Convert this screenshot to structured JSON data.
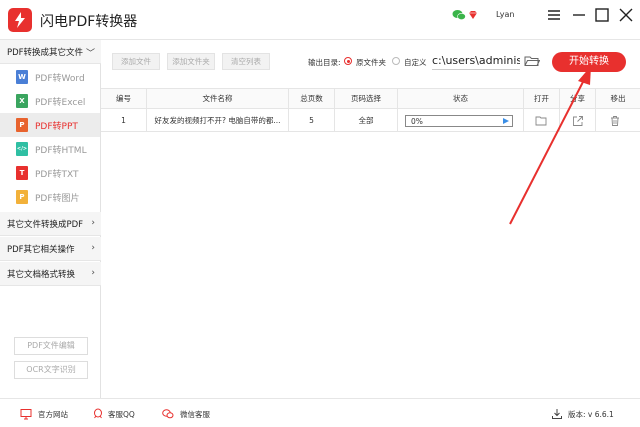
{
  "app": {
    "title": "闪电PDF转换器",
    "username": "Lyan"
  },
  "sidebar": {
    "section_pdf_to_other": "PDF转换成其它文件",
    "items": [
      {
        "label": "PDF转Word",
        "badge": "W",
        "color": "#4a7fd6"
      },
      {
        "label": "PDF转Excel",
        "badge": "X",
        "color": "#3aa55f"
      },
      {
        "label": "PDF转PPT",
        "badge": "P",
        "color": "#e8632e"
      },
      {
        "label": "PDF转HTML",
        "badge": "</>",
        "color": "#2fbfa3"
      },
      {
        "label": "PDF转TXT",
        "badge": "T",
        "color": "#e8302e"
      },
      {
        "label": "PDF转图片",
        "badge": "P",
        "color": "#f2b13a"
      }
    ],
    "section_other_to_pdf": "其它文件转换成PDF",
    "section_pdf_other_ops": "PDF其它相关操作",
    "section_other_formats": "其它文档格式转换",
    "btn_pdf_edit": "PDF文件编辑",
    "btn_ocr": "OCR文字识别"
  },
  "toolbar": {
    "add_file": "添加文件",
    "add_folder": "添加文件夹",
    "clear_list": "清空列表",
    "output_label": "输出目录:",
    "option_source": "原文件夹",
    "option_custom": "自定义",
    "path_value": "c:\\users\\administ",
    "start": "开始转换"
  },
  "table": {
    "headers": [
      "编号",
      "文件名称",
      "总页数",
      "页码选择",
      "状态",
      "打开",
      "分享",
      "移出"
    ],
    "rows": [
      {
        "index": "1",
        "filename": "好友发的视频打不开? 电脑自带的都...",
        "pages": "5",
        "range": "全部",
        "progress_text": "0%",
        "progress": 0
      }
    ]
  },
  "statusbar": {
    "website": "官方网站",
    "qq": "客服QQ",
    "wechat": "微信客服",
    "version": "版本: v 6.6.1"
  }
}
